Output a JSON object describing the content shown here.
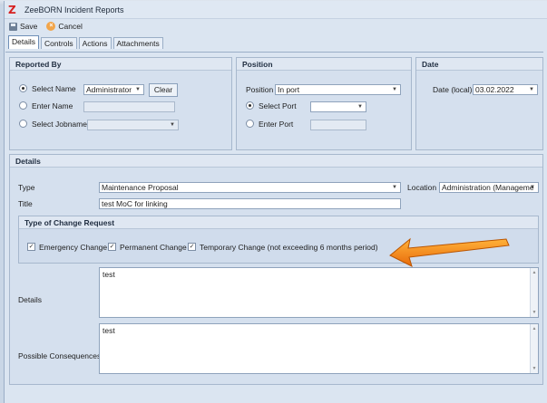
{
  "window": {
    "title": "ZeeBORN Incident Reports"
  },
  "toolbar": {
    "save_label": "Save",
    "cancel_label": "Cancel"
  },
  "tabs": [
    {
      "label": "Details",
      "active": true
    },
    {
      "label": "Controls"
    },
    {
      "label": "Actions"
    },
    {
      "label": "Attachments"
    }
  ],
  "reported_by": {
    "header": "Reported By",
    "select_name_label": "Select Name",
    "select_name_value": "Administrator",
    "clear_label": "Clear",
    "enter_name_label": "Enter Name",
    "select_jobname_label": "Select Jobname"
  },
  "position": {
    "header": "Position",
    "position_label": "Position",
    "position_value": "In port",
    "select_port_label": "Select Port",
    "enter_port_label": "Enter Port"
  },
  "date": {
    "header": "Date",
    "date_label": "Date (local)",
    "date_value": "03.02.2022"
  },
  "details": {
    "header": "Details",
    "type_label": "Type",
    "type_value": "Maintenance Proposal",
    "location_label": "Location",
    "location_value": "Administration (Manageme",
    "title_label": "Title",
    "title_value": "test MoC for linking",
    "change_request": {
      "header": "Type of Change Request",
      "emergency_label": "Emergency Change",
      "permanent_label": "Permanent Change",
      "temporary_label": "Temporary Change (not exceeding 6 months period)"
    },
    "details_label": "Details",
    "details_value": "test",
    "consequences_label": "Possible Consequences:",
    "consequences_value": "test"
  },
  "colors": {
    "annotation_arrow": "#f07a12",
    "accent": "#6f8fb7"
  }
}
